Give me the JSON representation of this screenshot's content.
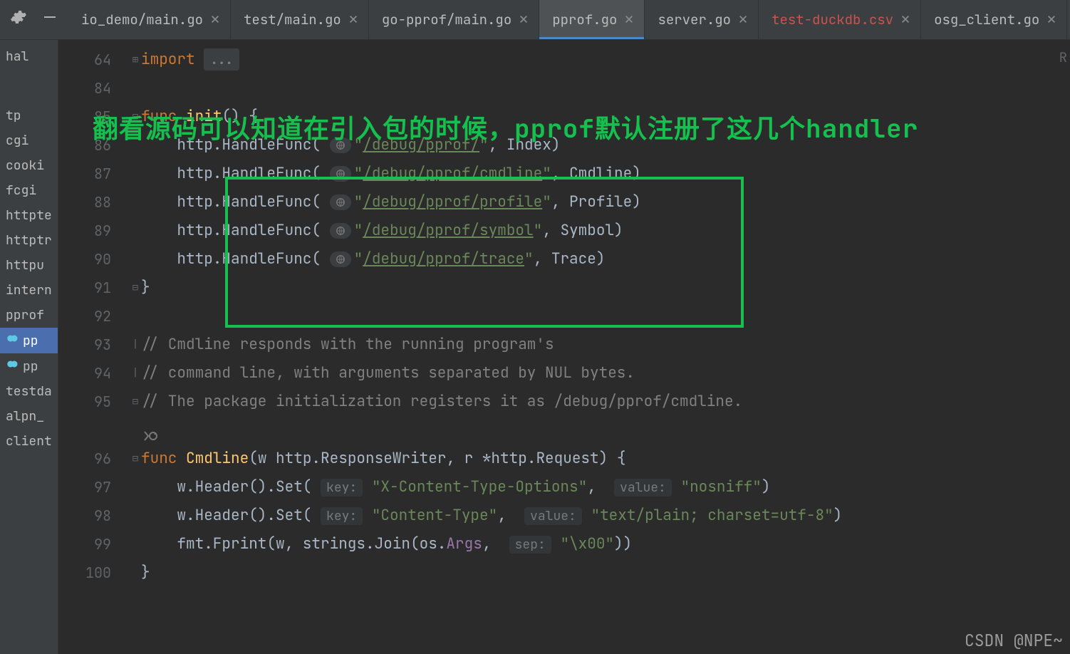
{
  "topbar": {
    "tabs": [
      {
        "label": "io_demo/main.go"
      },
      {
        "label": "test/main.go"
      },
      {
        "label": "go-pprof/main.go"
      },
      {
        "label": "pprof.go",
        "active": true
      },
      {
        "label": "server.go"
      },
      {
        "label": "test-duckdb.csv",
        "red": true
      },
      {
        "label": "osg_client.go"
      }
    ]
  },
  "sidebar": {
    "items": [
      {
        "label": "hal"
      },
      {
        "label": ""
      },
      {
        "label": ""
      },
      {
        "label": ""
      },
      {
        "label": ""
      },
      {
        "label": "tp"
      },
      {
        "label": "cgi"
      },
      {
        "label": "cooki"
      },
      {
        "label": "fcgi"
      },
      {
        "label": "httpte"
      },
      {
        "label": "httptr"
      },
      {
        "label": "httpu"
      },
      {
        "label": "intern"
      },
      {
        "label": "pprof"
      },
      {
        "label": "pp",
        "icon": true,
        "selected": true
      },
      {
        "label": "pp",
        "icon": true
      },
      {
        "label": "testda"
      },
      {
        "label": "alpn_"
      },
      {
        "label": "client"
      }
    ]
  },
  "annotation": "翻看源码可以知道在引入包的时候，pprof默认注册了这几个handler",
  "gutter": [
    "64",
    "84",
    "85",
    "86",
    "87",
    "88",
    "89",
    "90",
    "91",
    "92",
    "93",
    "94",
    "95",
    "",
    "96",
    "97",
    "98",
    "99",
    "100"
  ],
  "code": {
    "l64_import": "import",
    "l64_dots": "...",
    "l85_func": "func",
    "l85_name": "init",
    "l85_paren": "() {",
    "handle": "http.HandleFunc(",
    "q": "\"",
    "p1": "/debug/pprof/",
    "h1": "Index",
    "p2": "/debug/pprof/cmdline",
    "h2": "Cmdline",
    "p3": "/debug/pprof/profile",
    "h3": "Profile",
    "p4": "/debug/pprof/symbol",
    "h4": "Symbol",
    "p5": "/debug/pprof/trace",
    "h5": "Trace",
    "close_brace": "}",
    "c93": "// Cmdline responds with the running program's",
    "c94": "// command line, with arguments separated by NUL bytes.",
    "c95": "// The package initialization registers it as /debug/pprof/cmdline.",
    "l96_func": "func",
    "l96_name": "Cmdline",
    "l96_sig_a": "(w http.",
    "l96_rw": "ResponseWriter",
    "l96_sig_b": ", r *http.",
    "l96_req": "Request",
    "l96_sig_c": ") {",
    "wheader": "w.Header().Set(",
    "key_hint": "key:",
    "val_hint": "value:",
    "k97": "\"X-Content-Type-Options\"",
    "v97": "\"nosniff\"",
    "k98": "\"Content-Type\"",
    "v98": "\"text/plain; charset=utf-8\"",
    "l99a": "fmt.Fprint(w, strings.Join(os.",
    "l99args": "Args",
    "l99b": ",",
    "sep_hint": "sep:",
    "l99sep": "\"\\x00\"",
    "l99c": "))"
  },
  "right_edge": "R",
  "watermark": "CSDN @NPE~"
}
